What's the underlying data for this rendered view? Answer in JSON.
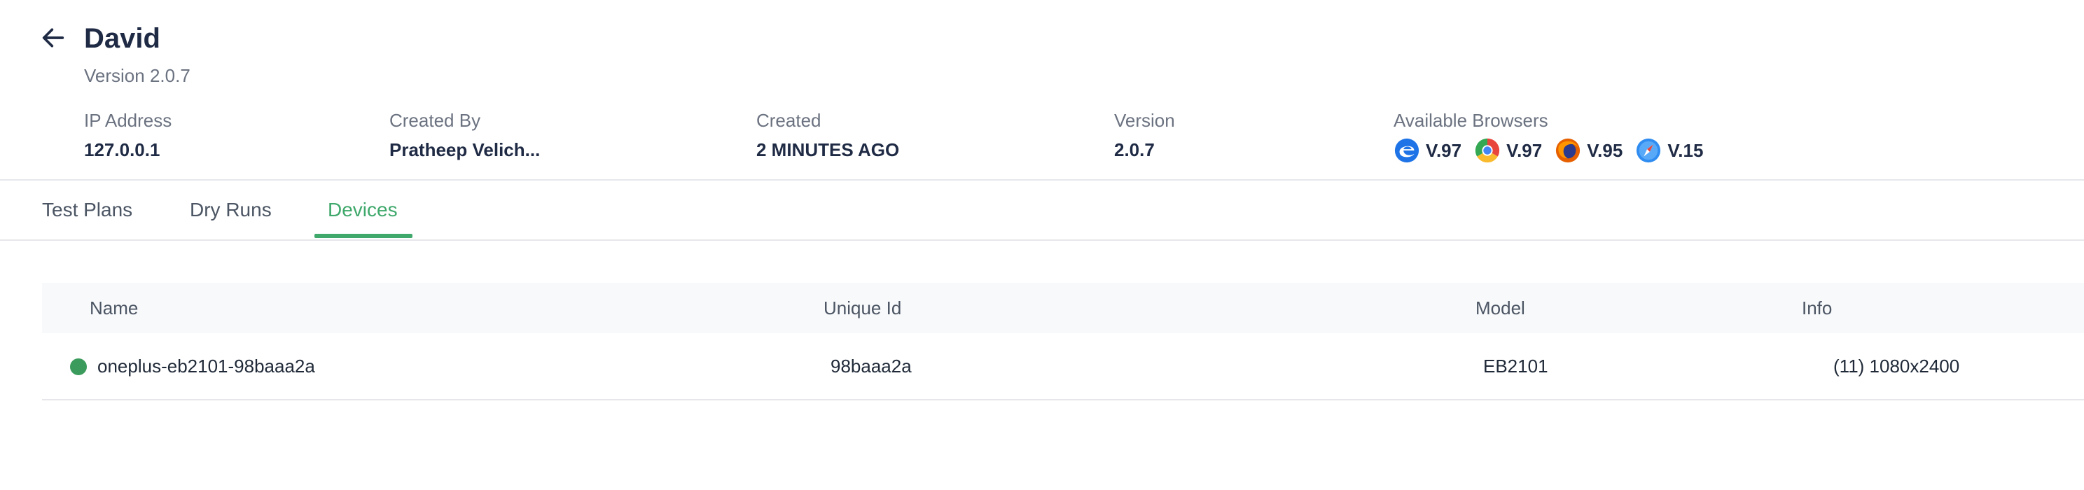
{
  "header": {
    "title": "David",
    "subtitle": "Version 2.0.7",
    "meta": [
      {
        "label": "IP Address",
        "value": "127.0.0.1"
      },
      {
        "label": "Created By",
        "value": "Pratheep Velich..."
      },
      {
        "label": "Created",
        "value": "2 MINUTES AGO"
      },
      {
        "label": "Version",
        "value": "2.0.7"
      }
    ],
    "browsers_label": "Available Browsers",
    "browsers": [
      {
        "icon": "edge-icon",
        "version": "V.97"
      },
      {
        "icon": "chrome-icon",
        "version": "V.97"
      },
      {
        "icon": "firefox-icon",
        "version": "V.95"
      },
      {
        "icon": "safari-icon",
        "version": "V.15"
      }
    ]
  },
  "tabs": [
    {
      "label": "Test Plans",
      "active": false
    },
    {
      "label": "Dry Runs",
      "active": false
    },
    {
      "label": "Devices",
      "active": true
    }
  ],
  "table": {
    "columns": [
      "Name",
      "Unique Id",
      "Model",
      "Info"
    ],
    "rows": [
      {
        "status": "online",
        "name": "oneplus-eb2101-98baaa2a",
        "unique_id": "98baaa2a",
        "model": "EB2101",
        "info": "(11) 1080x2400"
      }
    ]
  },
  "colors": {
    "accent": "#3fa86b",
    "status_online": "#3b9b5c",
    "text_primary": "#1f2a44",
    "text_secondary": "#6b7280"
  }
}
